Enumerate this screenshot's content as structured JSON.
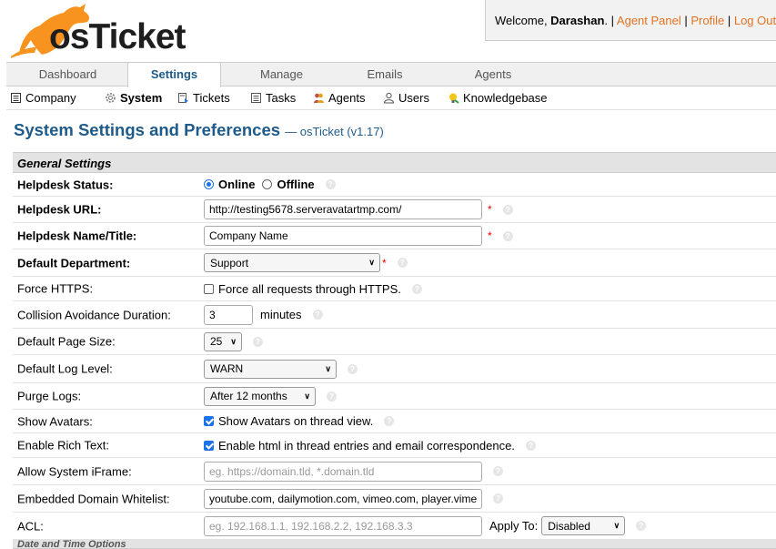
{
  "header": {
    "logo_text": "osTicket",
    "welcome_prefix": "Welcome, ",
    "user_name": "Darashan",
    "welcome_suffix": ". | ",
    "agent_panel": "Agent Panel",
    "sep1": " | ",
    "profile": "Profile",
    "sep2": " | ",
    "logout": "Log Out",
    "colors": {
      "brand": "#f7931e",
      "link": "#e37222",
      "title": "#1e5b8a"
    }
  },
  "nav": {
    "tabs": [
      {
        "label": "Dashboard",
        "active": false
      },
      {
        "label": "Settings",
        "active": true
      },
      {
        "label": "Manage",
        "active": false
      },
      {
        "label": "Emails",
        "active": false
      },
      {
        "label": "Agents",
        "active": false
      }
    ]
  },
  "subnav": {
    "items": [
      {
        "label": "Company",
        "icon": "company-icon"
      },
      {
        "label": "System",
        "icon": "gear-icon",
        "active": true
      },
      {
        "label": "Tickets",
        "icon": "ticket-icon"
      },
      {
        "label": "Tasks",
        "icon": "tasks-icon"
      },
      {
        "label": "Agents",
        "icon": "agents-icon"
      },
      {
        "label": "Users",
        "icon": "users-icon"
      },
      {
        "label": "Knowledgebase",
        "icon": "knowledgebase-icon"
      }
    ]
  },
  "page": {
    "title": "System Settings and Preferences",
    "subtitle": "— osTicket (v1.17)"
  },
  "settings": {
    "section_title": "General Settings",
    "helpdesk_status": {
      "label": "Helpdesk Status:",
      "online": "Online",
      "offline": "Offline",
      "selected": "Online"
    },
    "helpdesk_url": {
      "label": "Helpdesk URL:",
      "value": "http://testing5678.serveravatartmp.com/",
      "required": "*"
    },
    "helpdesk_name": {
      "label": "Helpdesk Name/Title:",
      "value": "Company Name",
      "required": "*"
    },
    "default_department": {
      "label": "Default Department:",
      "value": "Support",
      "required": "*"
    },
    "force_https": {
      "label": "Force HTTPS:",
      "text": "Force all requests through HTTPS.",
      "checked": false
    },
    "collision": {
      "label": "Collision Avoidance Duration:",
      "value": "3",
      "unit": "minutes"
    },
    "page_size": {
      "label": "Default Page Size:",
      "value": "25"
    },
    "log_level": {
      "label": "Default Log Level:",
      "value": "WARN"
    },
    "purge_logs": {
      "label": "Purge Logs:",
      "value": "After 12 months"
    },
    "show_avatars": {
      "label": "Show Avatars:",
      "text": "Show Avatars on thread view.",
      "checked": true
    },
    "rich_text": {
      "label": "Enable Rich Text:",
      "text": "Enable html in thread entries and email correspondence.",
      "checked": true
    },
    "iframe": {
      "label": "Allow System iFrame:",
      "value": "",
      "placeholder": "eg. https://domain.tld, *.domain.tld"
    },
    "whitelist": {
      "label": "Embedded Domain Whitelist:",
      "value": "youtube.com, dailymotion.com, vimeo.com, player.vimeo.com"
    },
    "acl": {
      "label": "ACL:",
      "value": "",
      "placeholder": "eg. 192.168.1.1, 192.168.2.2, 192.168.3.3",
      "apply_label": "Apply To:",
      "apply_value": "Disabled"
    },
    "next_section_title": "Date and Time Options"
  }
}
